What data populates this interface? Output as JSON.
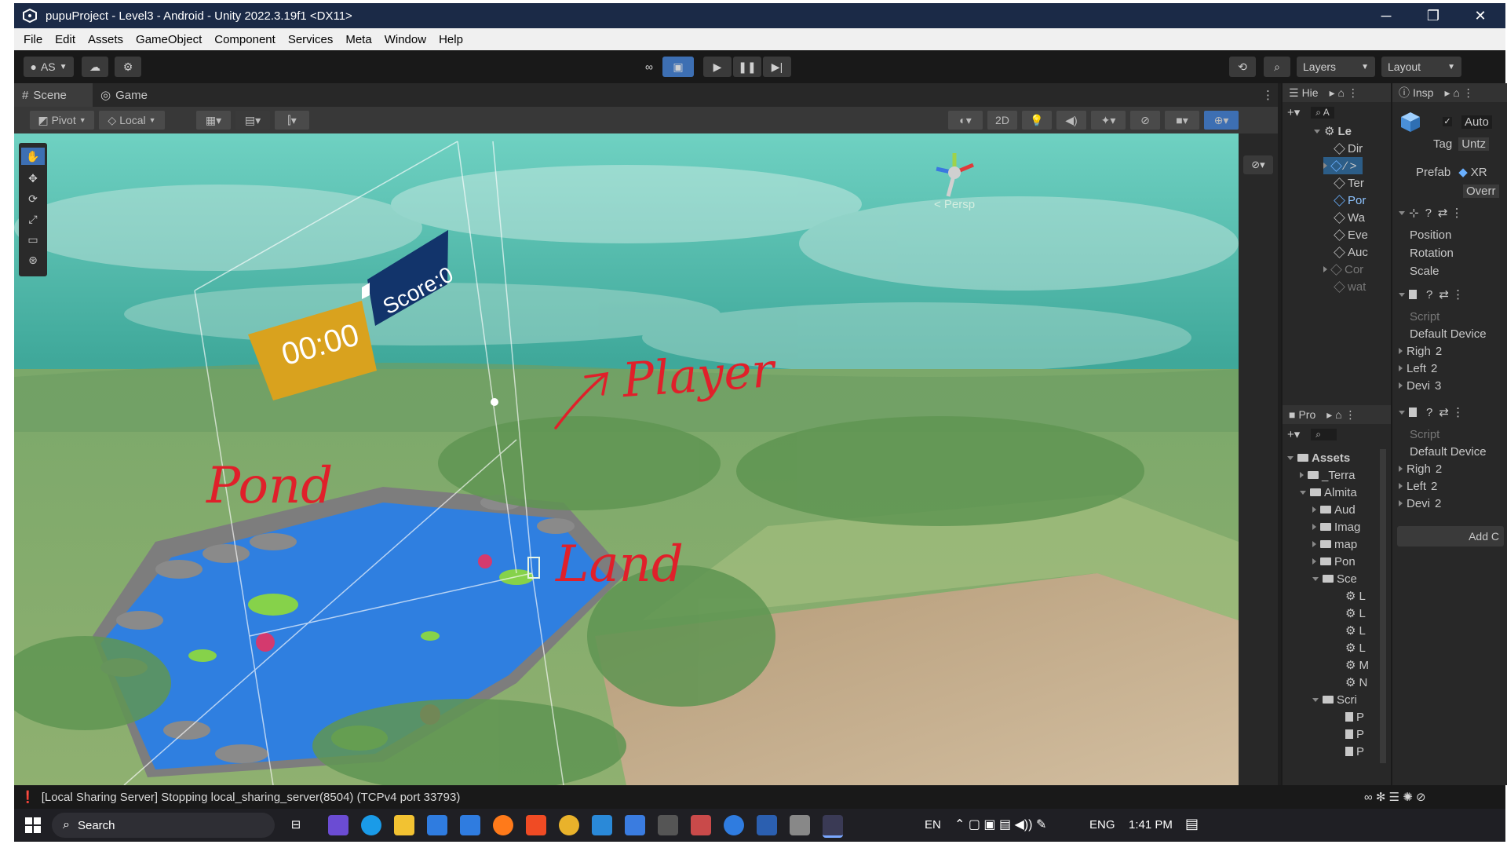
{
  "window": {
    "title": "pupuProject - Level3 - Android - Unity 2022.3.19f1 <DX11>",
    "controls": [
      "─",
      "❐",
      "✕"
    ]
  },
  "menu": [
    "File",
    "Edit",
    "Assets",
    "GameObject",
    "Component",
    "Services",
    "Meta",
    "Window",
    "Help"
  ],
  "toolbar": {
    "account": "AS",
    "layers": "Layers",
    "layout": "Layout"
  },
  "scene": {
    "tabs": [
      "Scene",
      "Game"
    ],
    "pivot": "Pivot",
    "local": "Local",
    "mode_2d": "2D",
    "persp": "< Persp",
    "score": "Score:0",
    "timer": "00:00",
    "annotations": {
      "player": "Player",
      "pond": "Pond",
      "land": "Land"
    }
  },
  "hierarchy": {
    "tab": "Hie",
    "search": "A",
    "root": "Le",
    "items": [
      "Dir",
      "∕ >",
      "Ter",
      "Por",
      "Wa",
      "Eve",
      "Auc",
      "Cor",
      "wat"
    ]
  },
  "project": {
    "tab": "Pro",
    "root": "Assets",
    "items": [
      "_Terra",
      "Almita",
      "Aud",
      "Imag",
      "map",
      "Pon",
      "Sce",
      "L",
      "L",
      "L",
      "L",
      "M",
      "N",
      "Scri",
      "P",
      "P",
      "P"
    ]
  },
  "inspector": {
    "tab": "Insp",
    "auto": "Auto",
    "tag_label": "Tag",
    "tag_value": "Untz",
    "prefab_label": "Prefab",
    "prefab_value": "XR",
    "override": "Overr",
    "transform": [
      "Position",
      "Rotation",
      "Scale"
    ],
    "comp1": {
      "script": "Script",
      "default": "Default Device",
      "rows": [
        [
          "Righ",
          "2"
        ],
        [
          "Left",
          "2"
        ],
        [
          "Devi",
          "3"
        ]
      ]
    },
    "comp2": {
      "script": "Script",
      "default": "Default Device",
      "rows": [
        [
          "Righ",
          "2"
        ],
        [
          "Left",
          "2"
        ],
        [
          "Devi",
          "2"
        ]
      ]
    },
    "add": "Add C"
  },
  "status": "[Local Sharing Server] Stopping local_sharing_server(8504) (TCPv4 port 33793)",
  "taskbar": {
    "search": "Search",
    "lang": "EN",
    "eng": "ENG",
    "time": "1:41 PM"
  },
  "colors": {
    "title_bar": "#1b2a47",
    "pond": "#2f7fe0",
    "score_panel": "#12346b",
    "timer_panel": "#d9a21e",
    "annotation_red": "#e0202a"
  }
}
